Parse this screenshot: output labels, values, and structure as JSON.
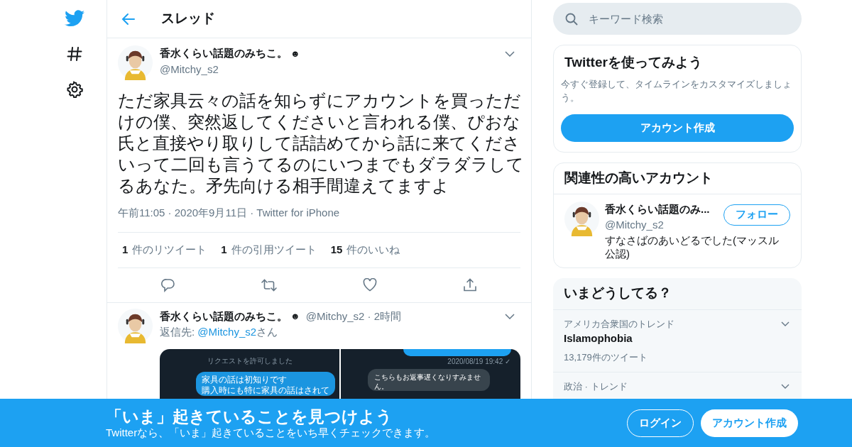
{
  "header": {
    "title": "スレッド"
  },
  "tweet": {
    "name": "香水くらい話題のみちこ。",
    "emoji": "☻",
    "handle": "@Mitchy_s2",
    "text": "ただ家具云々の話を知らずにアカウントを買っただけの僕、突然返してくださいと言われる僕、ぴおな氏と直接やり取りして話詰めてから話に来てくださいって二回も言うてるのにいつまでもダラダラしてるあなた。矛先向ける相手間違えてますよ",
    "meta": "午前11:05 · 2020年9月11日 · Twitter for iPhone",
    "stats": [
      {
        "count": "1",
        "label": "件のリツイート"
      },
      {
        "count": "1",
        "label": "件の引用ツイート"
      },
      {
        "count": "15",
        "label": "件のいいね"
      }
    ]
  },
  "reply": {
    "name": "香水くらい話題のみちこ。",
    "emoji": "☻",
    "meta": "@Mitchy_s2 · 2時間",
    "reply_prefix": "返信先: ",
    "reply_mention": "@Mitchy_s2",
    "reply_suffix": "さん",
    "media": {
      "left_notice": "リクエストを許可しました",
      "left_bubble": [
        "家具の話は初知りです",
        "購入時にも特に家具の話はされて"
      ],
      "right_timestamp": "2020/08/19 19:42 ✓",
      "right_bubble": [
        "こちらもお返事遅くなりすみませ",
        "ん。"
      ]
    }
  },
  "search": {
    "placeholder": "キーワード検索"
  },
  "signup_card": {
    "title": "Twitterを使ってみよう",
    "description": "今すぐ登録して、タイムラインをカスタマイズしましょう。",
    "button": "アカウント作成"
  },
  "related": {
    "title": "関連性の高いアカウント",
    "account": {
      "name": "香水くらい話題のみ...",
      "handle": "@Mitchy_s2",
      "bio": "すなさばのあいどるでした(マッスル公認)",
      "follow_button": "フォロー"
    }
  },
  "trends": {
    "title": "いまどうしてる？",
    "items": [
      {
        "context": "アメリカ合衆国のトレンド",
        "name": "Islamophobia",
        "count": "13,179件のツイート"
      },
      {
        "context": "政治 · トレンド"
      }
    ]
  },
  "banner": {
    "title": "「いま」起きていることを見つけよう",
    "subtitle": "Twitterなら、「いま」起きていることをいち早くチェックできます。",
    "login": "ログイン",
    "signup": "アカウント作成"
  }
}
